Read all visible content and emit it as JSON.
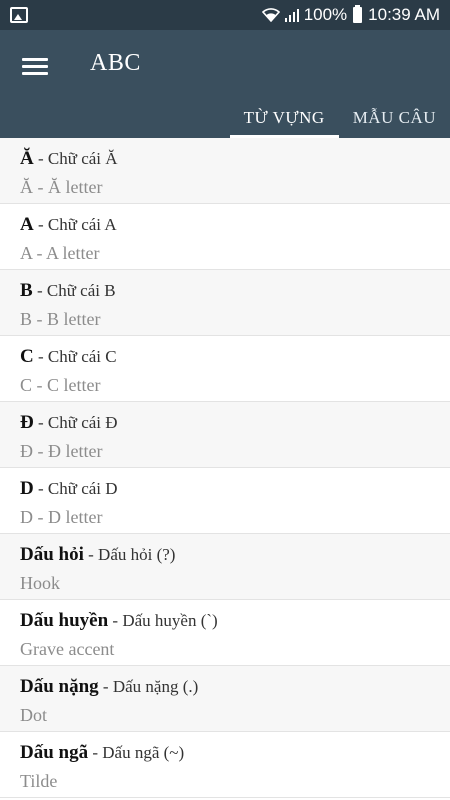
{
  "status_bar": {
    "left_icon": "image-notification-icon",
    "wifi_icon": "wifi-icon",
    "signal_icon": "signal-icon",
    "battery_percent": "100%",
    "battery_icon": "battery-icon",
    "time": "10:39 AM"
  },
  "app_bar": {
    "menu_icon": "hamburger-menu-icon",
    "title": "ABC",
    "tabs": [
      {
        "label": "TỪ VỰNG",
        "active": true
      },
      {
        "label": "MẪU CÂU",
        "active": false
      }
    ]
  },
  "items": [
    {
      "term": "Ă",
      "meaning": " - Chữ cái Ă",
      "translation": "Ă - Ă letter"
    },
    {
      "term": "A",
      "meaning": " - Chữ cái A",
      "translation": "A - A letter"
    },
    {
      "term": "B",
      "meaning": " - Chữ cái B",
      "translation": "B - B letter"
    },
    {
      "term": "C",
      "meaning": " - Chữ cái C",
      "translation": "C - C letter"
    },
    {
      "term": "Đ",
      "meaning": " - Chữ cái Đ",
      "translation": "Đ - Đ letter"
    },
    {
      "term": "D",
      "meaning": " - Chữ cái D",
      "translation": "D - D letter"
    },
    {
      "term": "Dấu hỏi",
      "meaning": " - Dấu hỏi (?)",
      "translation": "Hook"
    },
    {
      "term": "Dấu huyền",
      "meaning": " - Dấu huyền (`)",
      "translation": "Grave accent"
    },
    {
      "term": "Dấu nặng",
      "meaning": " - Dấu nặng (.)",
      "translation": "Dot"
    },
    {
      "term": "Dấu ngã",
      "meaning": " - Dấu ngã (~)",
      "translation": "Tilde"
    }
  ],
  "colors": {
    "status_bar": "#2b3b47",
    "app_bar": "#3a4f5e",
    "row_alt": "#f7f7f7",
    "secondary_text": "#8c8c8c"
  }
}
